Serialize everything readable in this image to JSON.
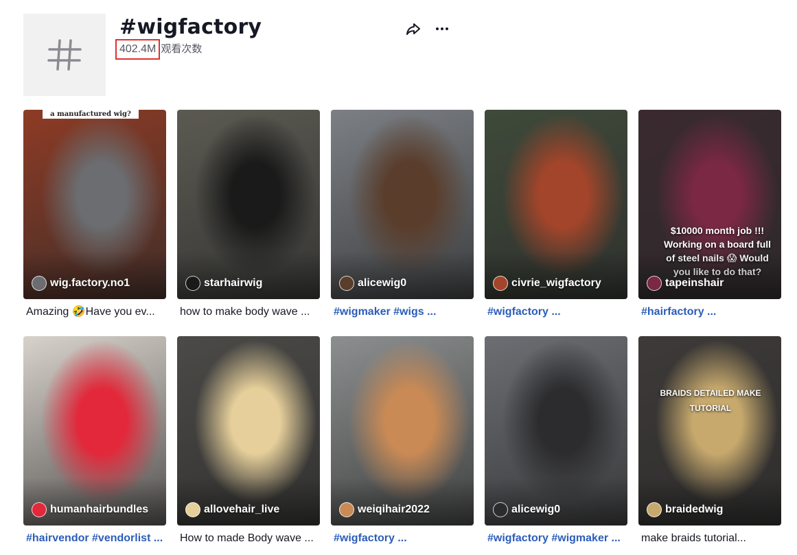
{
  "header": {
    "title": "#wigfactory",
    "views_count": "402.4M",
    "views_label": "观看次数",
    "tag_icon": "hashtag-icon",
    "share_icon": "share-icon",
    "more_icon": "more-icon"
  },
  "videos": [
    {
      "author": "wig.factory.no1",
      "caption": "Amazing 🤣Have you ev...",
      "caption_is_tags": false,
      "overlay": "a manufactured wig?",
      "bg": "#8e3b25",
      "accent": "#6b6d70"
    },
    {
      "author": "starhairwig",
      "caption": "how to make body wave ...",
      "caption_is_tags": false,
      "overlay": "",
      "bg": "#5b5a52",
      "accent": "#1a1a1a"
    },
    {
      "author": "alicewig0",
      "caption": "#wigmaker #wigs ...",
      "caption_is_tags": true,
      "overlay": "",
      "bg": "#7c8085",
      "accent": "#5a3d2b"
    },
    {
      "author": "civrie_wigfactory",
      "caption": "#wigfactory ...",
      "caption_is_tags": true,
      "overlay": "",
      "bg": "#3f4a3a",
      "accent": "#a3452a"
    },
    {
      "author": "tapeinshair",
      "caption": "#hairfactory ...",
      "caption_is_tags": true,
      "overlay": "$10000 month job !!! Working on a board full of steel nails 😱 Would you like to do that?",
      "bg": "#3a2a30",
      "accent": "#7a2844"
    },
    {
      "author": "humanhairbundles",
      "caption": "#hairvendor #vendorlist ...",
      "caption_is_tags": true,
      "overlay": "",
      "bg": "#d8d2cb",
      "accent": "#e2283a"
    },
    {
      "author": "allovehair_live",
      "caption": "How to made Body wave ...",
      "caption_is_tags": false,
      "overlay": "",
      "bg": "#4b4a47",
      "accent": "#e6cf9a"
    },
    {
      "author": "weiqihair2022",
      "caption": "#wigfactory ...",
      "caption_is_tags": true,
      "overlay": "",
      "bg": "#8c8f8f",
      "accent": "#c98a55"
    },
    {
      "author": "alicewig0",
      "caption": "#wigfactory #wigmaker ...",
      "caption_is_tags": true,
      "overlay": "",
      "bg": "#6c6e73",
      "accent": "#2c2c2e"
    },
    {
      "author": "braidedwig",
      "caption": "make braids tutorial...",
      "caption_is_tags": false,
      "overlay": "BRAIDS DETAILED MAKE TUTORIAL",
      "bg": "#3d3a38",
      "accent": "#c7a96d"
    }
  ],
  "colors": {
    "accent_link": "#2b5db9",
    "highlight_box": "#e0302b",
    "tag_bg": "#f1f1f2"
  }
}
